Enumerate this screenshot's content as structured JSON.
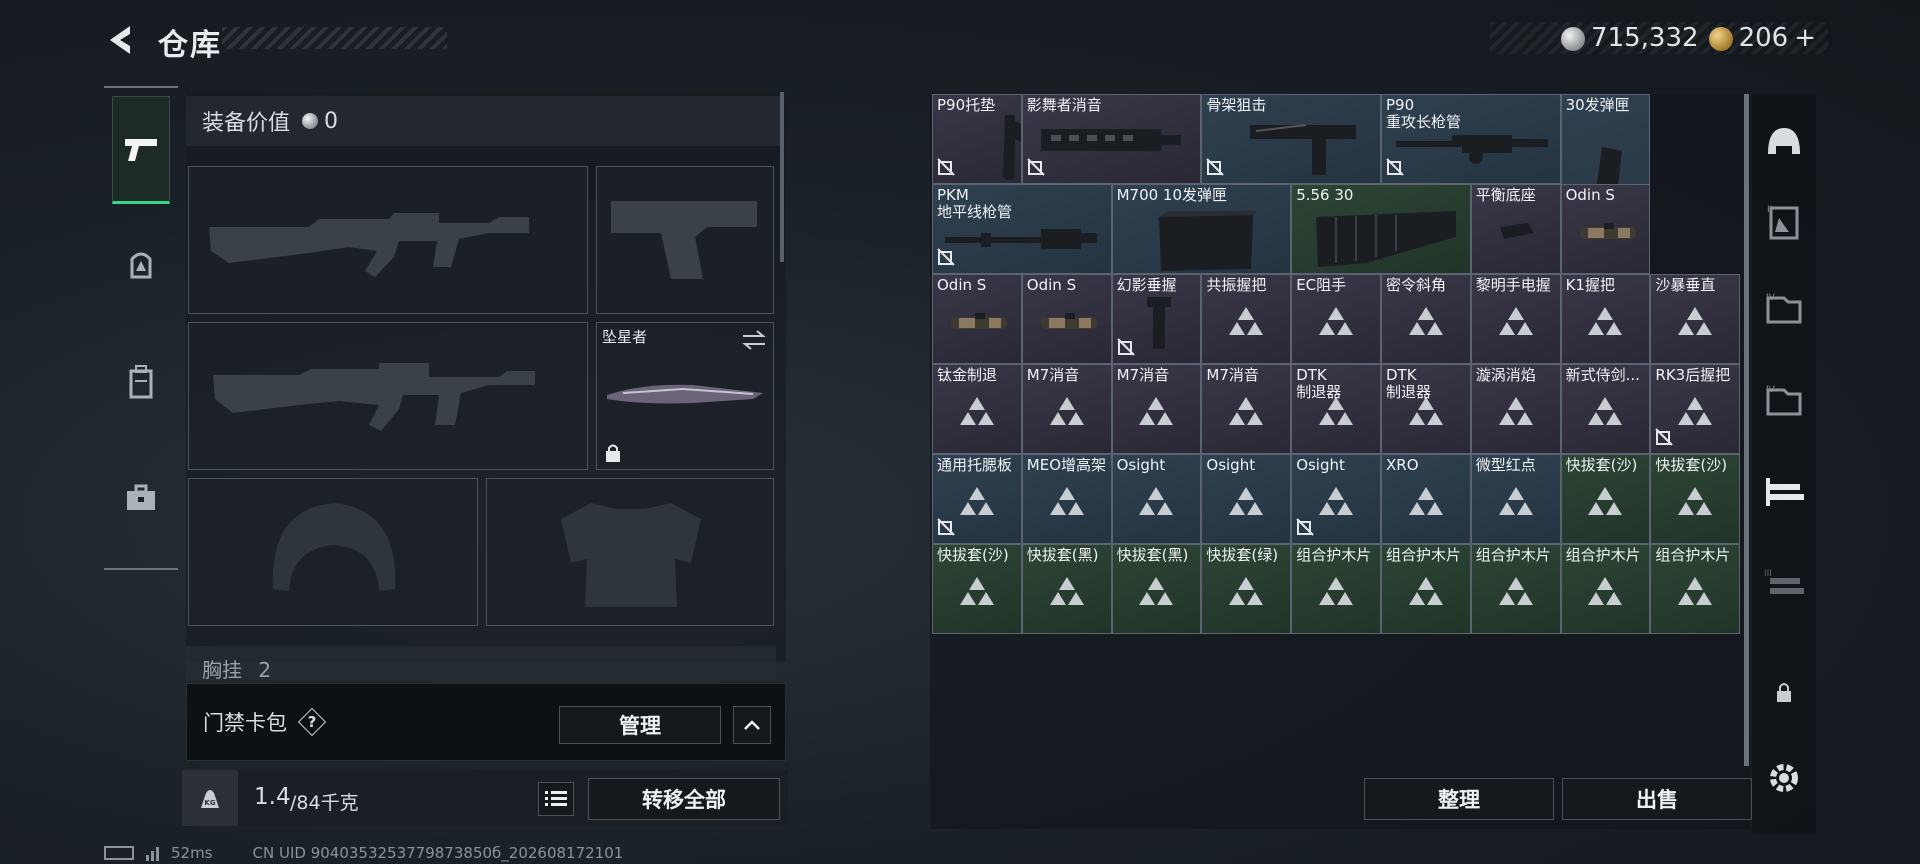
{
  "header": {
    "title": "仓库"
  },
  "currency": {
    "silver": "715,332",
    "gold": "206",
    "plus": "+"
  },
  "equipment": {
    "value_label": "装备价值",
    "value": "0",
    "melee_name": "坠星者",
    "chest_label": "胸挂",
    "chest_count": "2"
  },
  "keycard": {
    "label": "门禁卡包",
    "help": "?",
    "manage": "管理"
  },
  "weight": {
    "current": "1.4",
    "max": "/84千克",
    "kg_icon": "KG",
    "transfer_all": "转移全部"
  },
  "status": {
    "ping": "52ms",
    "uid": "CN UID 9040353253779873850б_202608172101"
  },
  "inventory": {
    "items": [
      {
        "label": "P90托垫",
        "rarity": "purple",
        "noicon": true,
        "img": "stock"
      },
      {
        "label": "影舞者消音",
        "rarity": "purple",
        "noicon": true,
        "img": "handguard"
      },
      {
        "label": "骨架狙击",
        "rarity": "blue",
        "noicon": true,
        "img": "buttstock"
      },
      {
        "label": "P90\n重攻长枪管",
        "rarity": "blue",
        "noicon": true,
        "img": "barrel"
      },
      {
        "label": "30发弹匣",
        "rarity": "blue",
        "noicon": true,
        "img": "mag-curved"
      },
      {
        "label": "PKM\n地平线枪管",
        "rarity": "blue",
        "noicon": true,
        "img": "pkm"
      },
      {
        "label": "M700 10发弹匣",
        "rarity": "blue",
        "noicon": false,
        "img": "mag-box"
      },
      {
        "label": "5.56 30",
        "rarity": "green",
        "noicon": false,
        "img": "mag-long"
      },
      {
        "label": "平衡底座",
        "rarity": "purple",
        "noicon": false,
        "img": "base"
      },
      {
        "label": "Odin S",
        "rarity": "purple",
        "noicon": false,
        "img": "light"
      },
      {
        "label": "Odin S",
        "rarity": "purple",
        "noicon": false,
        "img": "light"
      },
      {
        "label": "Odin S",
        "rarity": "purple",
        "noicon": false,
        "img": "light"
      },
      {
        "label": "幻影垂握",
        "rarity": "purple",
        "noicon": true,
        "img": "grip"
      },
      {
        "label": "共振握把",
        "rarity": "purple",
        "noicon": false,
        "img": "tri"
      },
      {
        "label": "EC阻手",
        "rarity": "purple",
        "noicon": false,
        "img": "tri"
      },
      {
        "label": "密令斜角",
        "rarity": "purple",
        "noicon": false,
        "img": "tri"
      },
      {
        "label": "黎明手电握",
        "rarity": "purple",
        "noicon": false,
        "img": "tri"
      },
      {
        "label": "K1握把",
        "rarity": "purple",
        "noicon": false,
        "img": "tri"
      },
      {
        "label": "沙暴垂直",
        "rarity": "purple",
        "noicon": false,
        "img": "tri"
      },
      {
        "label": "钛金制退",
        "rarity": "purple",
        "noicon": false,
        "img": "tri"
      },
      {
        "label": "M7消音",
        "rarity": "purple",
        "noicon": false,
        "img": "tri"
      },
      {
        "label": "M7消音",
        "rarity": "purple",
        "noicon": false,
        "img": "tri"
      },
      {
        "label": "M7消音",
        "rarity": "purple",
        "noicon": false,
        "img": "tri"
      },
      {
        "label": "DTK\n制退器",
        "rarity": "purple",
        "noicon": false,
        "img": "tri"
      },
      {
        "label": "DTK\n制退器",
        "rarity": "purple",
        "noicon": false,
        "img": "tri"
      },
      {
        "label": "漩涡消焰",
        "rarity": "purple",
        "noicon": false,
        "img": "tri"
      },
      {
        "label": "新式侍剑...",
        "rarity": "purple",
        "noicon": false,
        "img": "tri"
      },
      {
        "label": "RK3后握把",
        "rarity": "purple",
        "noicon": true,
        "img": "tri"
      },
      {
        "label": "通用托腮板",
        "rarity": "blue",
        "noicon": true,
        "img": "tri"
      },
      {
        "label": "MEO增高架",
        "rarity": "blue",
        "noicon": false,
        "img": "tri"
      },
      {
        "label": "Osight",
        "rarity": "blue",
        "noicon": false,
        "img": "tri"
      },
      {
        "label": "Osight",
        "rarity": "blue",
        "noicon": false,
        "img": "tri"
      },
      {
        "label": "Osight",
        "rarity": "blue",
        "noicon": true,
        "img": "tri"
      },
      {
        "label": "XRO",
        "rarity": "blue",
        "noicon": false,
        "img": "tri"
      },
      {
        "label": "微型红点",
        "rarity": "blue",
        "noicon": false,
        "img": "tri"
      },
      {
        "label": "快拔套(沙)",
        "rarity": "green",
        "noicon": false,
        "img": "tri"
      },
      {
        "label": "快拔套(沙)",
        "rarity": "green",
        "noicon": false,
        "img": "tri"
      },
      {
        "label": "快拔套(沙)",
        "rarity": "green",
        "noicon": false,
        "img": "tri"
      },
      {
        "label": "快拔套(黑)",
        "rarity": "green",
        "noicon": false,
        "img": "tri"
      },
      {
        "label": "快拔套(黑)",
        "rarity": "green",
        "noicon": false,
        "img": "tri"
      },
      {
        "label": "快拔套(绿)",
        "rarity": "green",
        "noicon": false,
        "img": "tri"
      },
      {
        "label": "组合护木片",
        "rarity": "green",
        "noicon": false,
        "img": "tri"
      },
      {
        "label": "组合护木片",
        "rarity": "green",
        "noicon": false,
        "img": "tri"
      },
      {
        "label": "组合护木片",
        "rarity": "green",
        "noicon": false,
        "img": "tri"
      },
      {
        "label": "组合护木片",
        "rarity": "green",
        "noicon": false,
        "img": "tri"
      },
      {
        "label": "组合护木片",
        "rarity": "green",
        "noicon": false,
        "img": "tri"
      }
    ],
    "sort": "整理",
    "sell": "出售"
  },
  "right_nav": {
    "items": [
      "helmet-icon",
      "backpack-2-icon",
      "ammo-crate-4-icon",
      "ammo-crate-4b-icon",
      "weapon-rack-icon",
      "weapon-rack-3-icon",
      "lock-icon",
      "settings-icon"
    ]
  },
  "colors": {
    "purple": "#3a3748",
    "blue": "#2f4050",
    "green": "#2d4535",
    "accent": "#36d68a"
  }
}
